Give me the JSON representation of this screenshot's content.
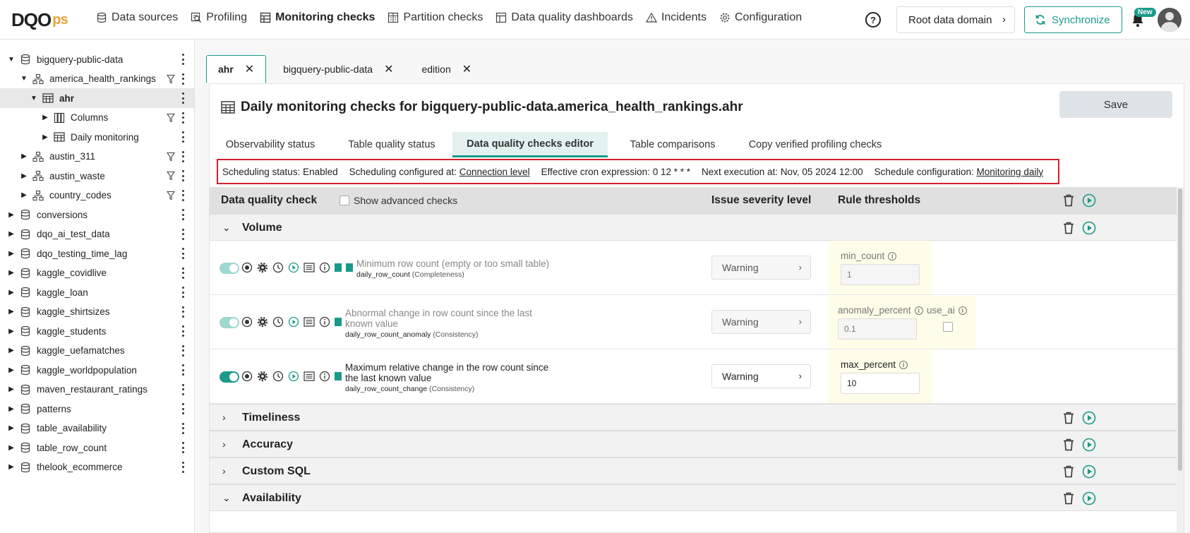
{
  "brand": {
    "logo_main": "DQO",
    "logo_suffix": "ps",
    "accent": "#1b9a8a",
    "highlight_border": "#d71e2b"
  },
  "nav": {
    "items": [
      {
        "label": "Data sources",
        "icon": "database-icon"
      },
      {
        "label": "Profiling",
        "icon": "profiling-icon"
      },
      {
        "label": "Monitoring checks",
        "icon": "table-icon"
      },
      {
        "label": "Partition checks",
        "icon": "partition-icon"
      },
      {
        "label": "Data quality dashboards",
        "icon": "dashboard-icon"
      },
      {
        "label": "Incidents",
        "icon": "warning-icon"
      },
      {
        "label": "Configuration",
        "icon": "gear-icon"
      }
    ],
    "help": "?",
    "domain": "Root data domain",
    "sync": "Synchronize",
    "new_badge": "New"
  },
  "tree": [
    {
      "label": "bigquery-public-data"
    },
    {
      "label": "america_health_rankings"
    },
    {
      "label": "ahr"
    },
    {
      "label": "Columns"
    },
    {
      "label": "Daily monitoring"
    },
    {
      "label": "austin_311"
    },
    {
      "label": "austin_waste"
    },
    {
      "label": "country_codes"
    },
    {
      "label": "conversions"
    },
    {
      "label": "dqo_ai_test_data"
    },
    {
      "label": "dqo_testing_time_lag"
    },
    {
      "label": "kaggle_covidlive"
    },
    {
      "label": "kaggle_loan"
    },
    {
      "label": "kaggle_shirtsizes"
    },
    {
      "label": "kaggle_students"
    },
    {
      "label": "kaggle_uefamatches"
    },
    {
      "label": "kaggle_worldpopulation"
    },
    {
      "label": "maven_restaurant_ratings"
    },
    {
      "label": "patterns"
    },
    {
      "label": "table_availability"
    },
    {
      "label": "table_row_count"
    },
    {
      "label": "thelook_ecommerce"
    }
  ],
  "tabs": [
    {
      "label": "ahr",
      "close": "✕"
    },
    {
      "label": "bigquery-public-data",
      "close": "✕"
    },
    {
      "label": "edition",
      "close": "✕"
    }
  ],
  "page": {
    "title": "Daily monitoring checks for bigquery-public-data.america_health_rankings.ahr",
    "save": "Save"
  },
  "subtabs": [
    "Observability status",
    "Table quality status",
    "Data quality checks editor",
    "Table comparisons",
    "Copy verified profiling checks"
  ],
  "schedule": {
    "status_label": "Scheduling status:",
    "status_value": "Enabled",
    "configured_label": "Scheduling configured at:",
    "configured_link": "Connection level",
    "cron_label": "Effective cron expression:",
    "cron_value": "0 12 * * *",
    "next_label": "Next execution at:",
    "next_value": "Nov, 05 2024 12:00",
    "config_label": "Schedule configuration:",
    "config_link": "Monitoring daily"
  },
  "table": {
    "col_check": "Data quality check",
    "show_advanced": "Show advanced checks",
    "col_severity": "Issue severity level",
    "col_thresholds": "Rule thresholds"
  },
  "groups": {
    "volume": "Volume",
    "timeliness": "Timeliness",
    "accuracy": "Accuracy",
    "custom_sql": "Custom SQL",
    "availability": "Availability"
  },
  "checks": [
    {
      "line1": "Minimum row count (empty or too small table)",
      "line2": "",
      "code": "daily_row_count",
      "category": " (Completeness)",
      "severity": "Warning",
      "params": [
        {
          "name": "min_count",
          "value": "1"
        }
      ]
    },
    {
      "line1": "Abnormal change in row count since the last",
      "line2": "known value",
      "code": "daily_row_count_anomaly",
      "category": " (Consistency)",
      "severity": "Warning",
      "params": [
        {
          "name": "anomaly_percent",
          "value": "0.1"
        },
        {
          "name": "use_ai",
          "value": ""
        }
      ]
    },
    {
      "line1": "Maximum relative change in the row count since",
      "line2": "the last known value",
      "code": "daily_row_count_change",
      "category": " (Consistency)",
      "severity": "Warning",
      "params": [
        {
          "name": "max_percent",
          "value": "10"
        }
      ]
    }
  ]
}
